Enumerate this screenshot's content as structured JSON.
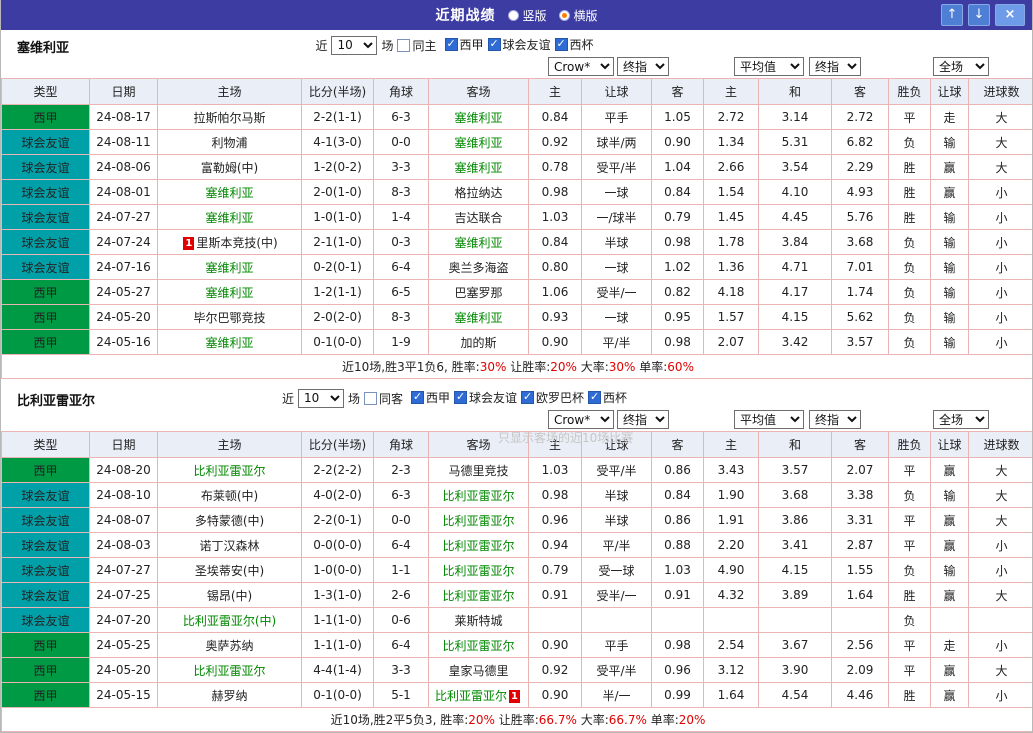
{
  "topbar": {
    "title": "近期战绩",
    "radios": [
      {
        "label": "竖版",
        "selected": false
      },
      {
        "label": "横版",
        "selected": true
      }
    ],
    "up_label": "↑",
    "down_label": "↓",
    "close_label": "×"
  },
  "colors": {
    "topbar_bg": "#3c3ca2",
    "liga_bg": "#009944",
    "friendly_bg": "#00a0a8",
    "team_green": "#008800",
    "score_red": "#d40000",
    "odds_navy": "#26269c",
    "result_red": "#e00000",
    "result_blue": "#2222cc",
    "grid_border": "#eab4b4",
    "header_bg": "#e9eef7"
  },
  "type_colors": {
    "西甲": "#009944",
    "球会友谊": "#00a0a8"
  },
  "result_red_values": [
    "胜",
    "赢",
    "走",
    "大"
  ],
  "card_badge_text": "1",
  "table_headers": [
    "类型",
    "日期",
    "主场",
    "比分(半场)",
    "角球",
    "客场",
    "主",
    "让球",
    "客",
    "主",
    "和",
    "客",
    "胜负",
    "让球",
    "进球数"
  ],
  "sections": [
    {
      "team": "塞维利亚",
      "filter": {
        "prefix": "近",
        "count": "10",
        "suffix": "场",
        "same": {
          "label": "同主",
          "checked": false
        },
        "leagues": [
          {
            "label": "西甲",
            "checked": true
          },
          {
            "label": "球会友谊",
            "checked": true
          },
          {
            "label": "西杯",
            "checked": true
          }
        ]
      },
      "selects": [
        {
          "name": "bookmaker-select",
          "value": "Crow*"
        },
        {
          "name": "handicap-final-odds-select",
          "value": "终指"
        },
        {
          "name": "europe-average-select",
          "value": "平均值"
        },
        {
          "name": "europe-final-odds-select",
          "value": "终指"
        },
        {
          "name": "scope-select",
          "value": "全场"
        }
      ],
      "rows": [
        {
          "type": "西甲",
          "date": "24-08-17",
          "home": "拉斯帕尔马斯",
          "home_team": false,
          "home_card": false,
          "score": "2-2(1-1)",
          "corner": "6-3",
          "away": "塞维利亚",
          "away_team": true,
          "away_card": false,
          "ah": [
            "0.84",
            "平手",
            "1.05"
          ],
          "eu": [
            "2.72",
            "3.14",
            "2.72"
          ],
          "result": "平",
          "ah_result": "走",
          "goal_result": "大"
        },
        {
          "type": "球会友谊",
          "date": "24-08-11",
          "home": "利物浦",
          "home_team": false,
          "home_card": false,
          "score": "4-1(3-0)",
          "corner": "0-0",
          "away": "塞维利亚",
          "away_team": true,
          "away_card": false,
          "ah": [
            "0.92",
            "球半/两",
            "0.90"
          ],
          "eu": [
            "1.34",
            "5.31",
            "6.82"
          ],
          "result": "负",
          "ah_result": "输",
          "goal_result": "大"
        },
        {
          "type": "球会友谊",
          "date": "24-08-06",
          "home": "富勒姆(中)",
          "home_team": false,
          "home_card": false,
          "score": "1-2(0-2)",
          "corner": "3-3",
          "away": "塞维利亚",
          "away_team": true,
          "away_card": false,
          "ah": [
            "0.78",
            "受平/半",
            "1.04"
          ],
          "eu": [
            "2.66",
            "3.54",
            "2.29"
          ],
          "result": "胜",
          "ah_result": "赢",
          "goal_result": "大"
        },
        {
          "type": "球会友谊",
          "date": "24-08-01",
          "home": "塞维利亚",
          "home_team": true,
          "home_card": false,
          "score": "2-0(1-0)",
          "corner": "8-3",
          "away": "格拉纳达",
          "away_team": false,
          "away_card": false,
          "ah": [
            "0.98",
            "一球",
            "0.84"
          ],
          "eu": [
            "1.54",
            "4.10",
            "4.93"
          ],
          "result": "胜",
          "ah_result": "赢",
          "goal_result": "小"
        },
        {
          "type": "球会友谊",
          "date": "24-07-27",
          "home": "塞维利亚",
          "home_team": true,
          "home_card": false,
          "score": "1-0(1-0)",
          "corner": "1-4",
          "away": "吉达联合",
          "away_team": false,
          "away_card": false,
          "ah": [
            "1.03",
            "一/球半",
            "0.79"
          ],
          "eu": [
            "1.45",
            "4.45",
            "5.76"
          ],
          "result": "胜",
          "ah_result": "输",
          "goal_result": "小"
        },
        {
          "type": "球会友谊",
          "date": "24-07-24",
          "home": "里斯本竞技(中)",
          "home_team": false,
          "home_card": true,
          "score": "2-1(1-0)",
          "corner": "0-3",
          "away": "塞维利亚",
          "away_team": true,
          "away_card": false,
          "ah": [
            "0.84",
            "半球",
            "0.98"
          ],
          "eu": [
            "1.78",
            "3.84",
            "3.68"
          ],
          "result": "负",
          "ah_result": "输",
          "goal_result": "小"
        },
        {
          "type": "球会友谊",
          "date": "24-07-16",
          "home": "塞维利亚",
          "home_team": true,
          "home_card": false,
          "score": "0-2(0-1)",
          "corner": "6-4",
          "away": "奥兰多海盗",
          "away_team": false,
          "away_card": false,
          "ah": [
            "0.80",
            "一球",
            "1.02"
          ],
          "eu": [
            "1.36",
            "4.71",
            "7.01"
          ],
          "result": "负",
          "ah_result": "输",
          "goal_result": "小"
        },
        {
          "type": "西甲",
          "date": "24-05-27",
          "home": "塞维利亚",
          "home_team": true,
          "home_card": false,
          "score": "1-2(1-1)",
          "corner": "6-5",
          "away": "巴塞罗那",
          "away_team": false,
          "away_card": false,
          "ah": [
            "1.06",
            "受半/一",
            "0.82"
          ],
          "eu": [
            "4.18",
            "4.17",
            "1.74"
          ],
          "result": "负",
          "ah_result": "输",
          "goal_result": "小"
        },
        {
          "type": "西甲",
          "date": "24-05-20",
          "home": "毕尔巴鄂竞技",
          "home_team": false,
          "home_card": false,
          "score": "2-0(2-0)",
          "corner": "8-3",
          "away": "塞维利亚",
          "away_team": true,
          "away_card": false,
          "ah": [
            "0.93",
            "一球",
            "0.95"
          ],
          "eu": [
            "1.57",
            "4.15",
            "5.62"
          ],
          "result": "负",
          "ah_result": "输",
          "goal_result": "小"
        },
        {
          "type": "西甲",
          "date": "24-05-16",
          "home": "塞维利亚",
          "home_team": true,
          "home_card": false,
          "score": "0-1(0-0)",
          "corner": "1-9",
          "away": "加的斯",
          "away_team": false,
          "away_card": false,
          "ah": [
            "0.90",
            "平/半",
            "0.98"
          ],
          "eu": [
            "2.07",
            "3.42",
            "3.57"
          ],
          "result": "负",
          "ah_result": "输",
          "goal_result": "小"
        }
      ],
      "summary": {
        "prefix": "近10场,胜3平1负6,",
        "stats": [
          {
            "label": "胜率:",
            "value": "30%"
          },
          {
            "label": "让胜率:",
            "value": "20%"
          },
          {
            "label": "大率:",
            "value": "30%"
          },
          {
            "label": "单率:",
            "value": "60%"
          }
        ]
      }
    },
    {
      "team": "比利亚雷亚尔",
      "watermark": "只显示客场的近10场比赛",
      "filter": {
        "prefix": "近",
        "count": "10",
        "suffix": "场",
        "same": {
          "label": "同客",
          "checked": false
        },
        "leagues": [
          {
            "label": "西甲",
            "checked": true
          },
          {
            "label": "球会友谊",
            "checked": true
          },
          {
            "label": "欧罗巴杯",
            "checked": true
          },
          {
            "label": "西杯",
            "checked": true
          }
        ]
      },
      "selects": [
        {
          "name": "bookmaker-select",
          "value": "Crow*"
        },
        {
          "name": "handicap-final-odds-select",
          "value": "终指"
        },
        {
          "name": "europe-average-select",
          "value": "平均值"
        },
        {
          "name": "europe-final-odds-select",
          "value": "终指"
        },
        {
          "name": "scope-select",
          "value": "全场"
        }
      ],
      "rows": [
        {
          "type": "西甲",
          "date": "24-08-20",
          "home": "比利亚雷亚尔",
          "home_team": true,
          "home_card": false,
          "score": "2-2(2-2)",
          "corner": "2-3",
          "away": "马德里竞技",
          "away_team": false,
          "away_card": false,
          "ah": [
            "1.03",
            "受平/半",
            "0.86"
          ],
          "eu": [
            "3.43",
            "3.57",
            "2.07"
          ],
          "result": "平",
          "ah_result": "赢",
          "goal_result": "大"
        },
        {
          "type": "球会友谊",
          "date": "24-08-10",
          "home": "布莱顿(中)",
          "home_team": false,
          "home_card": false,
          "score": "4-0(2-0)",
          "corner": "6-3",
          "away": "比利亚雷亚尔",
          "away_team": true,
          "away_card": false,
          "ah": [
            "0.98",
            "半球",
            "0.84"
          ],
          "eu": [
            "1.90",
            "3.68",
            "3.38"
          ],
          "result": "负",
          "ah_result": "输",
          "goal_result": "大"
        },
        {
          "type": "球会友谊",
          "date": "24-08-07",
          "home": "多特蒙德(中)",
          "home_team": false,
          "home_card": false,
          "score": "2-2(0-1)",
          "corner": "0-0",
          "away": "比利亚雷亚尔",
          "away_team": true,
          "away_card": false,
          "ah": [
            "0.96",
            "半球",
            "0.86"
          ],
          "eu": [
            "1.91",
            "3.86",
            "3.31"
          ],
          "result": "平",
          "ah_result": "赢",
          "goal_result": "大"
        },
        {
          "type": "球会友谊",
          "date": "24-08-03",
          "home": "诺丁汉森林",
          "home_team": false,
          "home_card": false,
          "score": "0-0(0-0)",
          "corner": "6-4",
          "away": "比利亚雷亚尔",
          "away_team": true,
          "away_card": false,
          "ah": [
            "0.94",
            "平/半",
            "0.88"
          ],
          "eu": [
            "2.20",
            "3.41",
            "2.87"
          ],
          "result": "平",
          "ah_result": "赢",
          "goal_result": "小"
        },
        {
          "type": "球会友谊",
          "date": "24-07-27",
          "home": "圣埃蒂安(中)",
          "home_team": false,
          "home_card": false,
          "score": "1-0(0-0)",
          "corner": "1-1",
          "away": "比利亚雷亚尔",
          "away_team": true,
          "away_card": false,
          "ah": [
            "0.79",
            "受一球",
            "1.03"
          ],
          "eu": [
            "4.90",
            "4.15",
            "1.55"
          ],
          "result": "负",
          "ah_result": "输",
          "goal_result": "小"
        },
        {
          "type": "球会友谊",
          "date": "24-07-25",
          "home": "锡昂(中)",
          "home_team": false,
          "home_card": false,
          "score": "1-3(1-0)",
          "corner": "2-6",
          "away": "比利亚雷亚尔",
          "away_team": true,
          "away_card": false,
          "ah": [
            "0.91",
            "受半/一",
            "0.91"
          ],
          "eu": [
            "4.32",
            "3.89",
            "1.64"
          ],
          "result": "胜",
          "ah_result": "赢",
          "goal_result": "大"
        },
        {
          "type": "球会友谊",
          "date": "24-07-20",
          "home": "比利亚雷亚尔(中)",
          "home_team": true,
          "home_card": false,
          "score": "1-1(1-0)",
          "corner": "0-6",
          "away": "莱斯特城",
          "away_team": false,
          "away_card": false,
          "ah": [
            "",
            "",
            ""
          ],
          "eu": [
            "",
            "",
            ""
          ],
          "result": "负",
          "ah_result": "",
          "goal_result": ""
        },
        {
          "type": "西甲",
          "date": "24-05-25",
          "home": "奥萨苏纳",
          "home_team": false,
          "home_card": false,
          "score": "1-1(1-0)",
          "corner": "6-4",
          "away": "比利亚雷亚尔",
          "away_team": true,
          "away_card": false,
          "ah": [
            "0.90",
            "平手",
            "0.98"
          ],
          "eu": [
            "2.54",
            "3.67",
            "2.56"
          ],
          "result": "平",
          "ah_result": "走",
          "goal_result": "小"
        },
        {
          "type": "西甲",
          "date": "24-05-20",
          "home": "比利亚雷亚尔",
          "home_team": true,
          "home_card": false,
          "score": "4-4(1-4)",
          "corner": "3-3",
          "away": "皇家马德里",
          "away_team": false,
          "away_card": false,
          "ah": [
            "0.92",
            "受平/半",
            "0.96"
          ],
          "eu": [
            "3.12",
            "3.90",
            "2.09"
          ],
          "result": "平",
          "ah_result": "赢",
          "goal_result": "大"
        },
        {
          "type": "西甲",
          "date": "24-05-15",
          "home": "赫罗纳",
          "home_team": false,
          "home_card": false,
          "score": "0-1(0-0)",
          "corner": "5-1",
          "away": "比利亚雷亚尔",
          "away_team": true,
          "away_card": true,
          "ah": [
            "0.90",
            "半/一",
            "0.99"
          ],
          "eu": [
            "1.64",
            "4.54",
            "4.46"
          ],
          "result": "胜",
          "ah_result": "赢",
          "goal_result": "小"
        }
      ],
      "summary": {
        "prefix": "近10场,胜2平5负3,",
        "stats": [
          {
            "label": "胜率:",
            "value": "20%"
          },
          {
            "label": "让胜率:",
            "value": "66.7%"
          },
          {
            "label": "大率:",
            "value": "66.7%"
          },
          {
            "label": "单率:",
            "value": "20%"
          }
        ]
      }
    }
  ]
}
